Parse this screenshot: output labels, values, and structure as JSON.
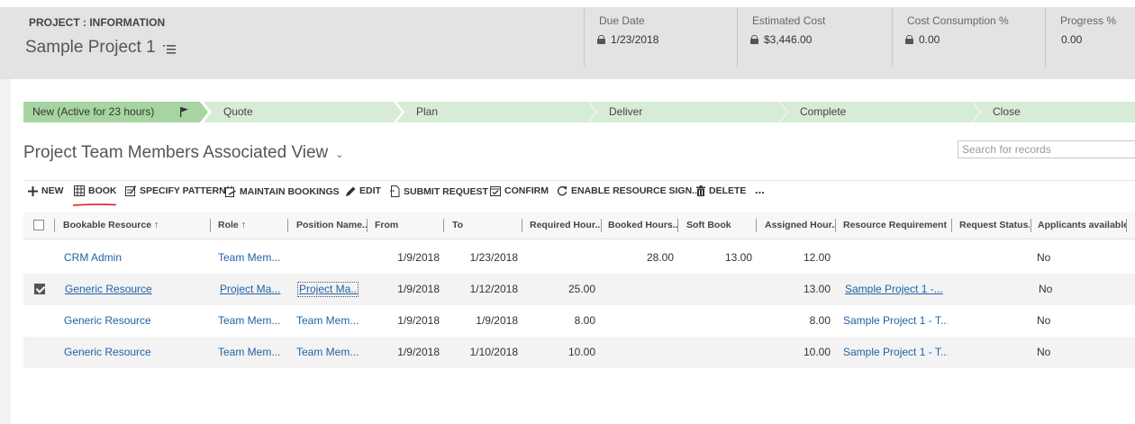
{
  "header": {
    "entity_label": "PROJECT : INFORMATION",
    "record_name": "Sample Project 1",
    "kpis": [
      {
        "label": "Due Date",
        "value": "1/23/2018",
        "locked": true
      },
      {
        "label": "Estimated Cost",
        "value": "$3,446.00",
        "locked": true
      },
      {
        "label": "Cost Consumption %",
        "value": "0.00",
        "locked": true
      },
      {
        "label": "Progress %",
        "value": "0.00",
        "locked": false
      }
    ]
  },
  "process": {
    "stages": [
      {
        "label": "New (Active for 23 hours)",
        "active": true
      },
      {
        "label": "Quote"
      },
      {
        "label": "Plan"
      },
      {
        "label": "Deliver"
      },
      {
        "label": "Complete"
      },
      {
        "label": "Close"
      }
    ]
  },
  "view": {
    "title": "Project Team Members Associated View",
    "search_placeholder": "Search for records"
  },
  "toolbar": {
    "new": "NEW",
    "book": "BOOK",
    "specify_pattern": "SPECIFY PATTERN",
    "maintain_bookings": "MAINTAIN BOOKINGS",
    "edit": "EDIT",
    "submit_request": "SUBMIT REQUEST",
    "confirm": "CONFIRM",
    "enable_resource_sign": "ENABLE RESOURCE SIGN...",
    "delete": "DELETE",
    "more": "..."
  },
  "grid": {
    "columns": [
      "Bookable Resource ↑",
      "Role ↑",
      "Position Name...",
      "From",
      "To",
      "Required Hour...",
      "Booked Hours...",
      "Soft Book",
      "Assigned Hour...",
      "Resource Requirement",
      "Request Status...",
      "Applicants available"
    ],
    "rows": [
      {
        "resource": "CRM Admin",
        "role": "Team Mem...",
        "position": "",
        "from": "1/9/2018",
        "to": "1/23/2018",
        "required": "",
        "booked": "28.00",
        "soft": "13.00",
        "assigned": "12.00",
        "requirement": "",
        "status": "",
        "applicants": "No",
        "checked": false
      },
      {
        "resource": "Generic Resource",
        "role": "Project Ma...",
        "position": "Project Ma...",
        "from": "1/9/2018",
        "to": "1/12/2018",
        "required": "25.00",
        "booked": "",
        "soft": "",
        "assigned": "13.00",
        "requirement": "Sample Project 1 -...",
        "status": "",
        "applicants": "No",
        "checked": true
      },
      {
        "resource": "Generic Resource",
        "role": "Team Mem...",
        "position": "Team Mem...",
        "from": "1/9/2018",
        "to": "1/9/2018",
        "required": "8.00",
        "booked": "",
        "soft": "",
        "assigned": "8.00",
        "requirement": "Sample Project 1 - T...",
        "status": "",
        "applicants": "No",
        "checked": false
      },
      {
        "resource": "Generic Resource",
        "role": "Team Mem...",
        "position": "Team Mem...",
        "from": "1/9/2018",
        "to": "1/10/2018",
        "required": "10.00",
        "booked": "",
        "soft": "",
        "assigned": "10.00",
        "requirement": "Sample Project 1 - T...",
        "status": "",
        "applicants": "No",
        "checked": false
      }
    ]
  }
}
